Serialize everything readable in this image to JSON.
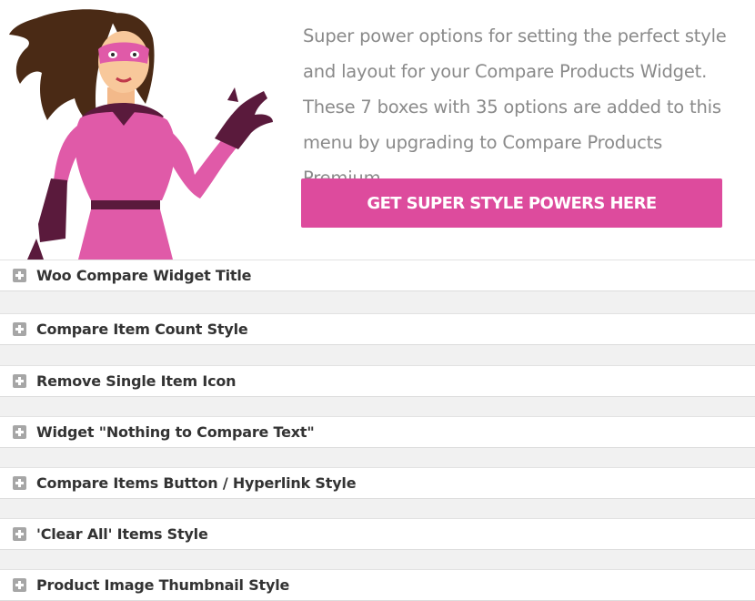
{
  "promo": {
    "description": "Super power options for setting the perfect style and layout for your Compare Products Widget. These 7 boxes with 35 options are added to this menu by upgrading to Compare Products Premium.",
    "cta_label": "GET SUPER STYLE POWERS HERE"
  },
  "colors": {
    "accent": "#dd4b9d",
    "heroine_suit": "#e05aa8",
    "heroine_dark": "#5a1a3c"
  },
  "sections": [
    {
      "label": "Woo Compare Widget Title",
      "icon": "plus-icon"
    },
    {
      "label": "Compare Item Count Style",
      "icon": "plus-icon"
    },
    {
      "label": "Remove Single Item Icon",
      "icon": "plus-icon"
    },
    {
      "label": "Widget \"Nothing to Compare Text\"",
      "icon": "plus-icon"
    },
    {
      "label": "Compare Items Button / Hyperlink Style",
      "icon": "plus-icon"
    },
    {
      "label": "'Clear All' Items Style",
      "icon": "plus-icon"
    },
    {
      "label": "Product Image Thumbnail Style",
      "icon": "plus-icon"
    }
  ]
}
